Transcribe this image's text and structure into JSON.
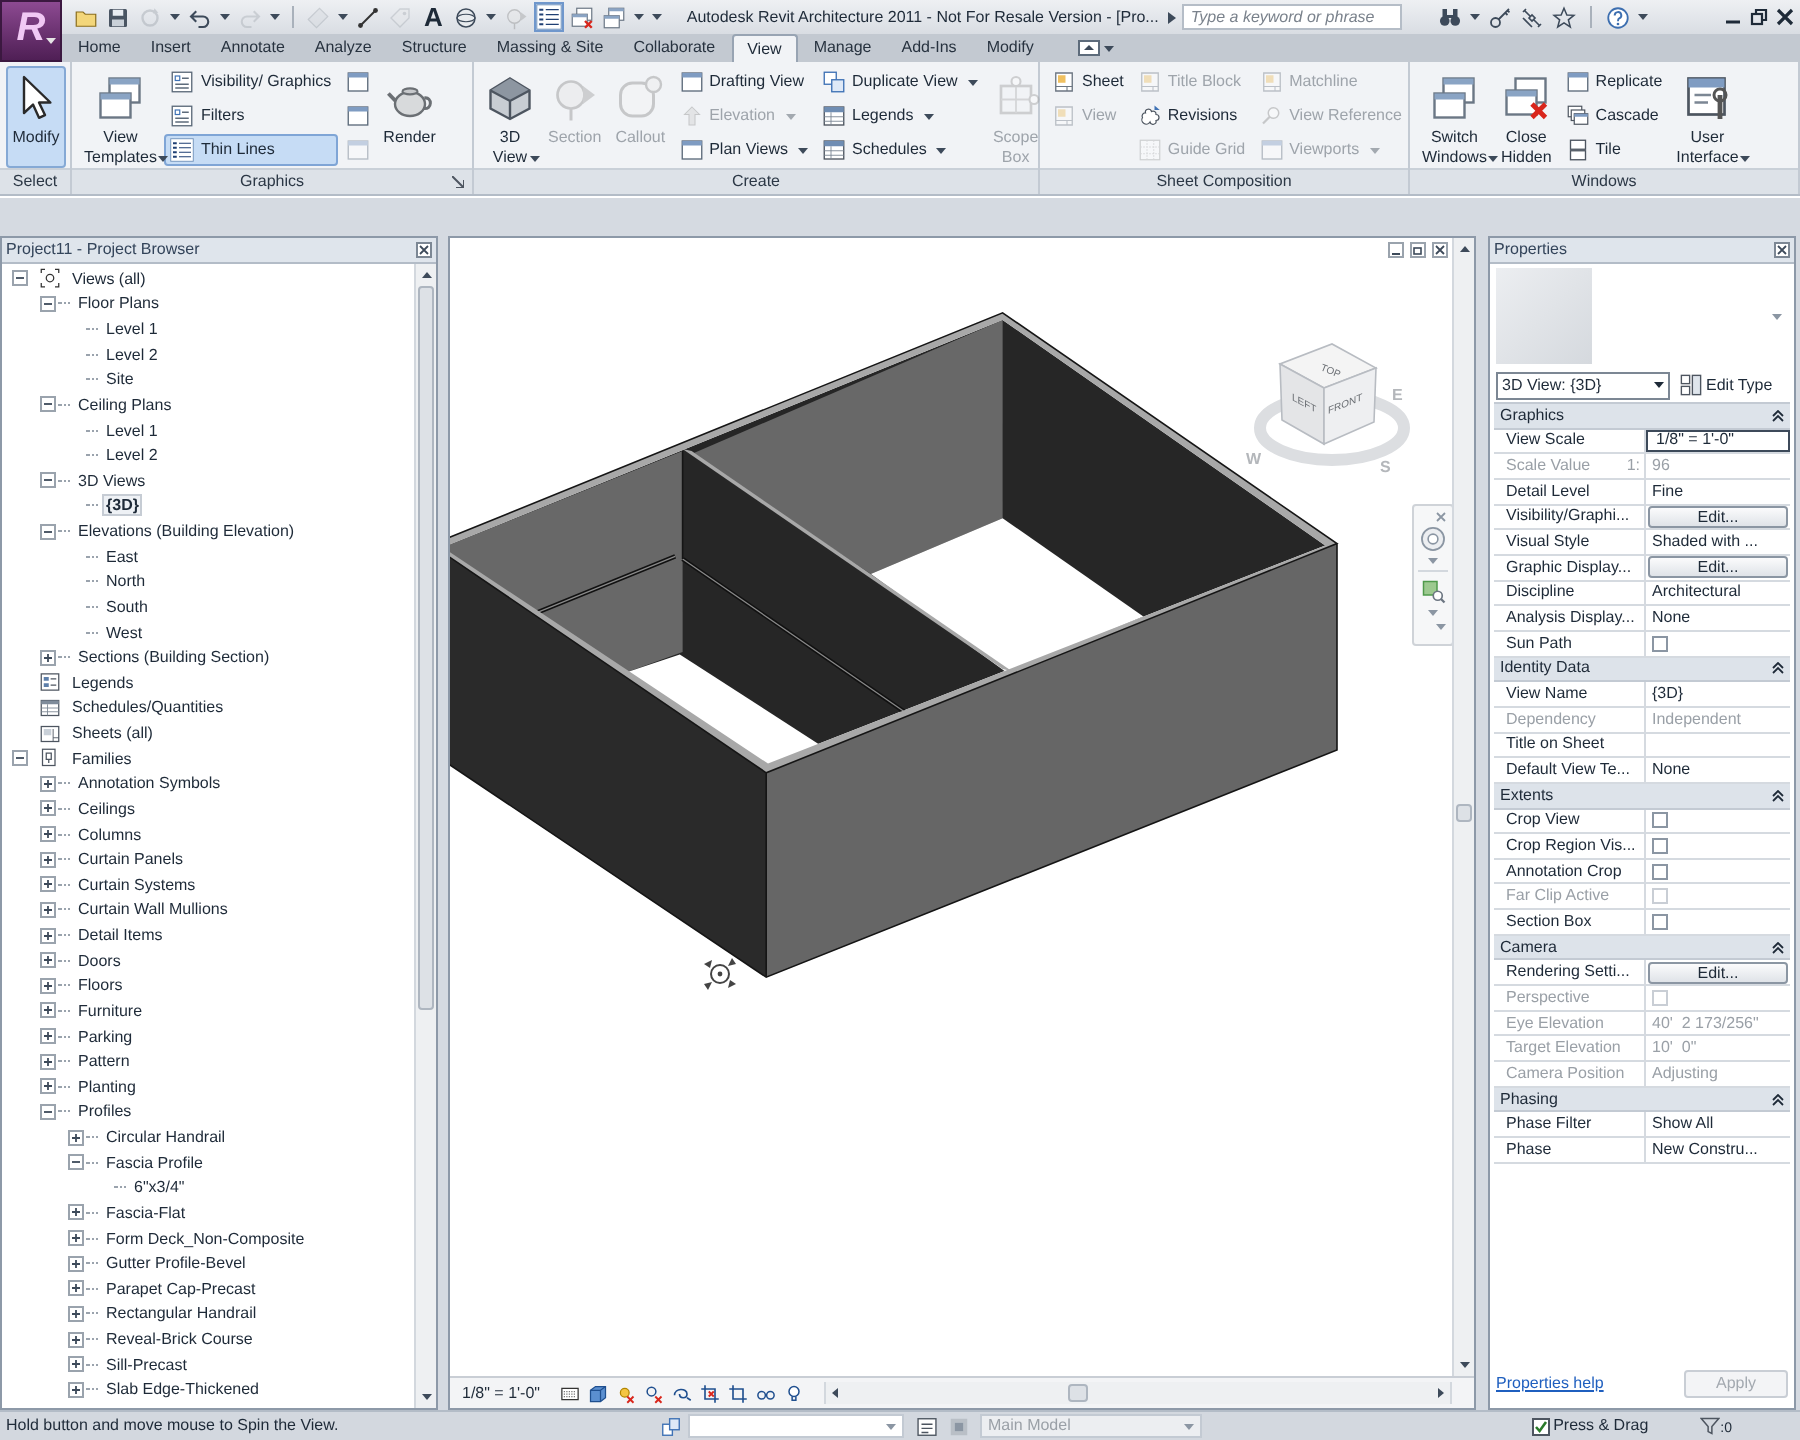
{
  "app_button": {
    "logo": "R"
  },
  "title_bar": {
    "text_tool": "A",
    "title": "Autodesk Revit Architecture 2011 - Not For Resale Version - [Pro...",
    "search": {
      "placeholder": "Type a keyword or phrase"
    }
  },
  "tabs": [
    {
      "label": "Home",
      "selected": false
    },
    {
      "label": "Insert",
      "selected": false
    },
    {
      "label": "Annotate",
      "selected": false
    },
    {
      "label": "Analyze",
      "selected": false
    },
    {
      "label": "Structure",
      "selected": false
    },
    {
      "label": "Massing & Site",
      "selected": false
    },
    {
      "label": "Collaborate",
      "selected": false
    },
    {
      "label": "View",
      "selected": true
    },
    {
      "label": "Manage",
      "selected": false
    },
    {
      "label": "Add-Ins",
      "selected": false
    },
    {
      "label": "Modify",
      "selected": false
    }
  ],
  "ribbon": [
    {
      "title": "Select",
      "launcher": false,
      "columns": [
        {
          "kind": "large",
          "items": [
            {
              "label": "Modify",
              "on": true,
              "disabled": false,
              "menu": false
            }
          ]
        }
      ]
    },
    {
      "title": "Graphics",
      "launcher": true,
      "columns": [
        {
          "kind": "large",
          "items": [
            {
              "label": "View Templates",
              "on": false,
              "disabled": false,
              "menu": true
            }
          ]
        },
        {
          "kind": "stack",
          "items": [
            {
              "label": "Visibility/ Graphics",
              "on": false,
              "disabled": false,
              "menu": false
            },
            {
              "label": "Filters",
              "on": false,
              "disabled": false,
              "menu": false
            },
            {
              "label": "Thin Lines",
              "on": true,
              "disabled": false,
              "menu": false
            }
          ]
        },
        {
          "kind": "icons",
          "items": [
            {
              "on": false,
              "disabled": false,
              "menu": false
            },
            {
              "on": false,
              "disabled": false,
              "menu": false
            },
            {
              "on": false,
              "disabled": true,
              "menu": false
            }
          ]
        },
        {
          "kind": "large",
          "items": [
            {
              "label": "Render",
              "on": false,
              "disabled": false,
              "menu": false
            }
          ]
        }
      ]
    },
    {
      "title": "Create",
      "launcher": false,
      "columns": [
        {
          "kind": "large",
          "items": [
            {
              "label": "3D View",
              "on": false,
              "disabled": false,
              "menu": true
            }
          ]
        },
        {
          "kind": "large",
          "items": [
            {
              "label": "Section",
              "on": false,
              "disabled": true,
              "menu": false
            }
          ]
        },
        {
          "kind": "large",
          "items": [
            {
              "label": "Callout",
              "on": false,
              "disabled": true,
              "menu": false
            }
          ]
        },
        {
          "kind": "stack",
          "items": [
            {
              "label": "Drafting View",
              "on": false,
              "disabled": false,
              "menu": false
            },
            {
              "label": "Elevation",
              "on": false,
              "disabled": true,
              "menu": true
            },
            {
              "label": "Plan Views",
              "on": false,
              "disabled": false,
              "menu": true
            }
          ]
        },
        {
          "kind": "stack",
          "items": [
            {
              "label": "Duplicate View",
              "on": false,
              "disabled": false,
              "menu": true
            },
            {
              "label": "Legends",
              "on": false,
              "disabled": false,
              "menu": true
            },
            {
              "label": "Schedules",
              "on": false,
              "disabled": false,
              "menu": true
            }
          ]
        },
        {
          "kind": "large",
          "items": [
            {
              "label": "Scope Box",
              "on": false,
              "disabled": true,
              "menu": false
            }
          ]
        }
      ]
    },
    {
      "title": "Sheet Composition",
      "launcher": false,
      "columns": [
        {
          "kind": "stack",
          "items": [
            {
              "label": "Sheet",
              "on": false,
              "disabled": false,
              "menu": false
            },
            {
              "label": "View",
              "on": false,
              "disabled": true,
              "menu": false
            }
          ]
        },
        {
          "kind": "stack",
          "items": [
            {
              "label": "Title Block",
              "on": false,
              "disabled": true,
              "menu": false
            },
            {
              "label": "Revisions",
              "on": false,
              "disabled": false,
              "menu": false
            },
            {
              "label": "Guide Grid",
              "on": false,
              "disabled": true,
              "menu": false
            }
          ]
        },
        {
          "kind": "stack",
          "items": [
            {
              "label": "Matchline",
              "on": false,
              "disabled": true,
              "menu": false
            },
            {
              "label": "View Reference",
              "on": false,
              "disabled": true,
              "menu": false
            },
            {
              "label": "Viewports",
              "on": false,
              "disabled": true,
              "menu": true
            }
          ]
        }
      ]
    },
    {
      "title": "Windows",
      "launcher": false,
      "columns": [
        {
          "kind": "large",
          "items": [
            {
              "label": "Switch Windows",
              "on": false,
              "disabled": false,
              "menu": true
            }
          ]
        },
        {
          "kind": "large",
          "items": [
            {
              "label": "Close Hidden",
              "on": false,
              "disabled": false,
              "menu": false
            }
          ]
        },
        {
          "kind": "stack",
          "items": [
            {
              "label": "Replicate",
              "on": false,
              "disabled": false,
              "menu": false
            },
            {
              "label": "Cascade",
              "on": false,
              "disabled": false,
              "menu": false
            },
            {
              "label": "Tile",
              "on": false,
              "disabled": false,
              "menu": false
            }
          ]
        },
        {
          "kind": "large",
          "items": [
            {
              "label": "User Interface",
              "on": false,
              "disabled": false,
              "menu": true
            }
          ]
        }
      ]
    }
  ],
  "project_browser": {
    "title": "Project11 - Project Browser",
    "tree": [
      {
        "label": "Views (all)",
        "expanded": true,
        "selected": false,
        "children": [
          {
            "label": "Floor Plans",
            "expanded": true,
            "selected": false,
            "children": [
              {
                "label": "Level 1",
                "selected": false
              },
              {
                "label": "Level 2",
                "selected": false
              },
              {
                "label": "Site",
                "selected": false
              }
            ]
          },
          {
            "label": "Ceiling Plans",
            "expanded": true,
            "selected": false,
            "children": [
              {
                "label": "Level 1",
                "selected": false
              },
              {
                "label": "Level 2",
                "selected": false
              }
            ]
          },
          {
            "label": "3D Views",
            "expanded": true,
            "selected": false,
            "children": [
              {
                "label": "{3D}",
                "selected": true
              }
            ]
          },
          {
            "label": "Elevations (Building Elevation)",
            "expanded": true,
            "selected": false,
            "children": [
              {
                "label": "East",
                "selected": false
              },
              {
                "label": "North",
                "selected": false
              },
              {
                "label": "South",
                "selected": false
              },
              {
                "label": "West",
                "selected": false
              }
            ]
          },
          {
            "label": "Sections (Building Section)",
            "expanded": false,
            "selected": false
          }
        ]
      },
      {
        "label": "Legends",
        "selected": false
      },
      {
        "label": "Schedules/Quantities",
        "selected": false
      },
      {
        "label": "Sheets (all)",
        "selected": false
      },
      {
        "label": "Families",
        "expanded": true,
        "selected": false,
        "children": [
          {
            "label": "Annotation Symbols",
            "expanded": false,
            "selected": false
          },
          {
            "label": "Ceilings",
            "expanded": false,
            "selected": false
          },
          {
            "label": "Columns",
            "expanded": false,
            "selected": false
          },
          {
            "label": "Curtain Panels",
            "expanded": false,
            "selected": false
          },
          {
            "label": "Curtain Systems",
            "expanded": false,
            "selected": false
          },
          {
            "label": "Curtain Wall Mullions",
            "expanded": false,
            "selected": false
          },
          {
            "label": "Detail Items",
            "expanded": false,
            "selected": false
          },
          {
            "label": "Doors",
            "expanded": false,
            "selected": false
          },
          {
            "label": "Floors",
            "expanded": false,
            "selected": false
          },
          {
            "label": "Furniture",
            "expanded": false,
            "selected": false
          },
          {
            "label": "Parking",
            "expanded": false,
            "selected": false
          },
          {
            "label": "Pattern",
            "expanded": false,
            "selected": false
          },
          {
            "label": "Planting",
            "expanded": false,
            "selected": false
          },
          {
            "label": "Profiles",
            "expanded": true,
            "selected": false,
            "children": [
              {
                "label": "Circular Handrail",
                "expanded": false,
                "selected": false
              },
              {
                "label": "Fascia Profile",
                "expanded": true,
                "selected": false,
                "children": [
                  {
                    "label": "6\"x3/4\"",
                    "selected": false
                  }
                ]
              },
              {
                "label": "Fascia-Flat",
                "expanded": false,
                "selected": false
              },
              {
                "label": "Form Deck_Non-Composite",
                "expanded": false,
                "selected": false
              },
              {
                "label": "Gutter Profile-Bevel",
                "expanded": false,
                "selected": false
              },
              {
                "label": "Parapet Cap-Precast",
                "expanded": false,
                "selected": false
              },
              {
                "label": "Rectangular Handrail",
                "expanded": false,
                "selected": false
              },
              {
                "label": "Reveal-Brick Course",
                "expanded": false,
                "selected": false
              },
              {
                "label": "Sill-Precast",
                "expanded": false,
                "selected": false
              },
              {
                "label": "Slab Edge-Thickened",
                "expanded": false,
                "selected": false
              }
            ]
          }
        ]
      }
    ]
  },
  "view_cube": {
    "faces": [
      "TOP",
      "LEFT",
      "FRONT"
    ],
    "compass": [
      "W",
      "S",
      "E"
    ]
  },
  "view_control_bar": {
    "scale": "1/8\" = 1'-0\""
  },
  "properties": {
    "title": "Properties",
    "type_selector": "3D View: {3D}",
    "edit_type": "Edit Type",
    "groups": [
      {
        "title": "Graphics",
        "expanded": true,
        "rows": [
          {
            "kind": "input",
            "name": "View Scale",
            "value": "1/8\" = 1'-0\"",
            "disabled": false
          },
          {
            "kind": "text",
            "name": "Scale Value",
            "name_suffix": "1:",
            "value": "96",
            "disabled": true
          },
          {
            "kind": "text",
            "name": "Detail Level",
            "value": "Fine",
            "disabled": false
          },
          {
            "kind": "button",
            "name": "Visibility/Graphi...",
            "value": "Edit...",
            "disabled": false
          },
          {
            "kind": "text",
            "name": "Visual Style",
            "value": "Shaded with ...",
            "disabled": false
          },
          {
            "kind": "button",
            "name": "Graphic Display...",
            "value": "Edit...",
            "disabled": false
          },
          {
            "kind": "text",
            "name": "Discipline",
            "value": "Architectural",
            "disabled": false
          },
          {
            "kind": "text",
            "name": "Analysis Display...",
            "value": "None",
            "disabled": false
          },
          {
            "kind": "checkbox",
            "name": "Sun Path",
            "checked": false,
            "disabled": false
          }
        ]
      },
      {
        "title": "Identity Data",
        "expanded": true,
        "rows": [
          {
            "kind": "text",
            "name": "View Name",
            "value": "{3D}",
            "disabled": false
          },
          {
            "kind": "text",
            "name": "Dependency",
            "value": "Independent",
            "disabled": true
          },
          {
            "kind": "text",
            "name": "Title on Sheet",
            "disabled": false
          },
          {
            "kind": "text",
            "name": "Default View Te...",
            "value": "None",
            "disabled": false
          }
        ]
      },
      {
        "title": "Extents",
        "expanded": true,
        "rows": [
          {
            "kind": "checkbox",
            "name": "Crop View",
            "checked": false,
            "disabled": false
          },
          {
            "kind": "checkbox",
            "name": "Crop Region Vis...",
            "checked": false,
            "disabled": false
          },
          {
            "kind": "checkbox",
            "name": "Annotation Crop",
            "checked": false,
            "disabled": false
          },
          {
            "kind": "checkbox",
            "name": "Far Clip Active",
            "checked": false,
            "disabled": true
          },
          {
            "kind": "checkbox",
            "name": "Section Box",
            "checked": false,
            "disabled": false
          }
        ]
      },
      {
        "title": "Camera",
        "expanded": true,
        "rows": [
          {
            "kind": "button",
            "name": "Rendering Setti...",
            "value": "Edit...",
            "disabled": false
          },
          {
            "kind": "checkbox",
            "name": "Perspective",
            "checked": false,
            "disabled": true
          },
          {
            "kind": "text",
            "name": "Eye Elevation",
            "value": "40'  2 173/256\"",
            "disabled": true
          },
          {
            "kind": "text",
            "name": "Target Elevation",
            "value": "10'  0\"",
            "disabled": true
          },
          {
            "kind": "text",
            "name": "Camera Position",
            "value": "Adjusting",
            "disabled": true
          }
        ]
      },
      {
        "title": "Phasing",
        "expanded": true,
        "rows": [
          {
            "kind": "text",
            "name": "Phase Filter",
            "value": "Show All",
            "disabled": false
          },
          {
            "kind": "text",
            "name": "Phase",
            "value": "New Constru...",
            "disabled": false
          }
        ]
      }
    ],
    "help_link": "Properties help",
    "apply": {
      "label": "Apply",
      "disabled": true
    }
  },
  "status_bar": {
    "message": "Hold button and move mouse to Spin the View.",
    "design_option": {
      "value": "Main Model",
      "disabled": true
    },
    "press_drag": {
      "label": "Press & Drag",
      "checked": true
    },
    "filter_count": ":0"
  }
}
